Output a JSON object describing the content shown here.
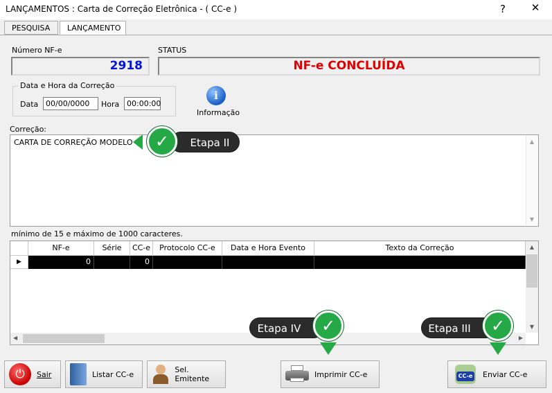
{
  "window": {
    "title": "LANÇAMENTOS : Carta de Correção Eletrônica - ( CC-e )",
    "help": "?",
    "close": "✕"
  },
  "tabs": [
    {
      "label": "PESQUISA"
    },
    {
      "label": "LANÇAMENTO"
    }
  ],
  "nf": {
    "label": "Número NF-e",
    "value": "2918"
  },
  "status": {
    "label": "STATUS",
    "value": "NF-e CONCLUÍDA"
  },
  "datetime": {
    "group_title": "Data e Hora da Correção",
    "date_label": "Data",
    "date_value": "00/00/0000",
    "time_label": "Hora",
    "time_value": "00:00:00"
  },
  "info": {
    "label": "Informação",
    "icon": "info-icon"
  },
  "correction": {
    "label": "Correção:",
    "text": "CARTA DE CORREÇÃO MODELO",
    "hint": "mínimo de 15 e máximo de 1000 caracteres."
  },
  "grid": {
    "columns": [
      "NF-e",
      "Série",
      "CC-e",
      "Protocolo CC-e",
      "Data e Hora Evento",
      "Texto da Correção"
    ],
    "rows": [
      {
        "nfe": "0",
        "serie": "",
        "cce": "0",
        "protocolo": "",
        "data": "",
        "texto": ""
      }
    ]
  },
  "buttons": {
    "sair": "Sair",
    "listar": "Listar CC-e",
    "emitente": "Sel. Emitente",
    "imprimir": "Imprimir CC-e",
    "enviar": "Enviar CC-e"
  },
  "callouts": {
    "etapa2": "Etapa II",
    "etapa3": "Etapa III",
    "etapa4": "Etapa IV"
  },
  "colors": {
    "nf_number": "#0014d8",
    "status": "#e00000",
    "callout_green": "#25a946",
    "grid_selected": "#000000"
  }
}
